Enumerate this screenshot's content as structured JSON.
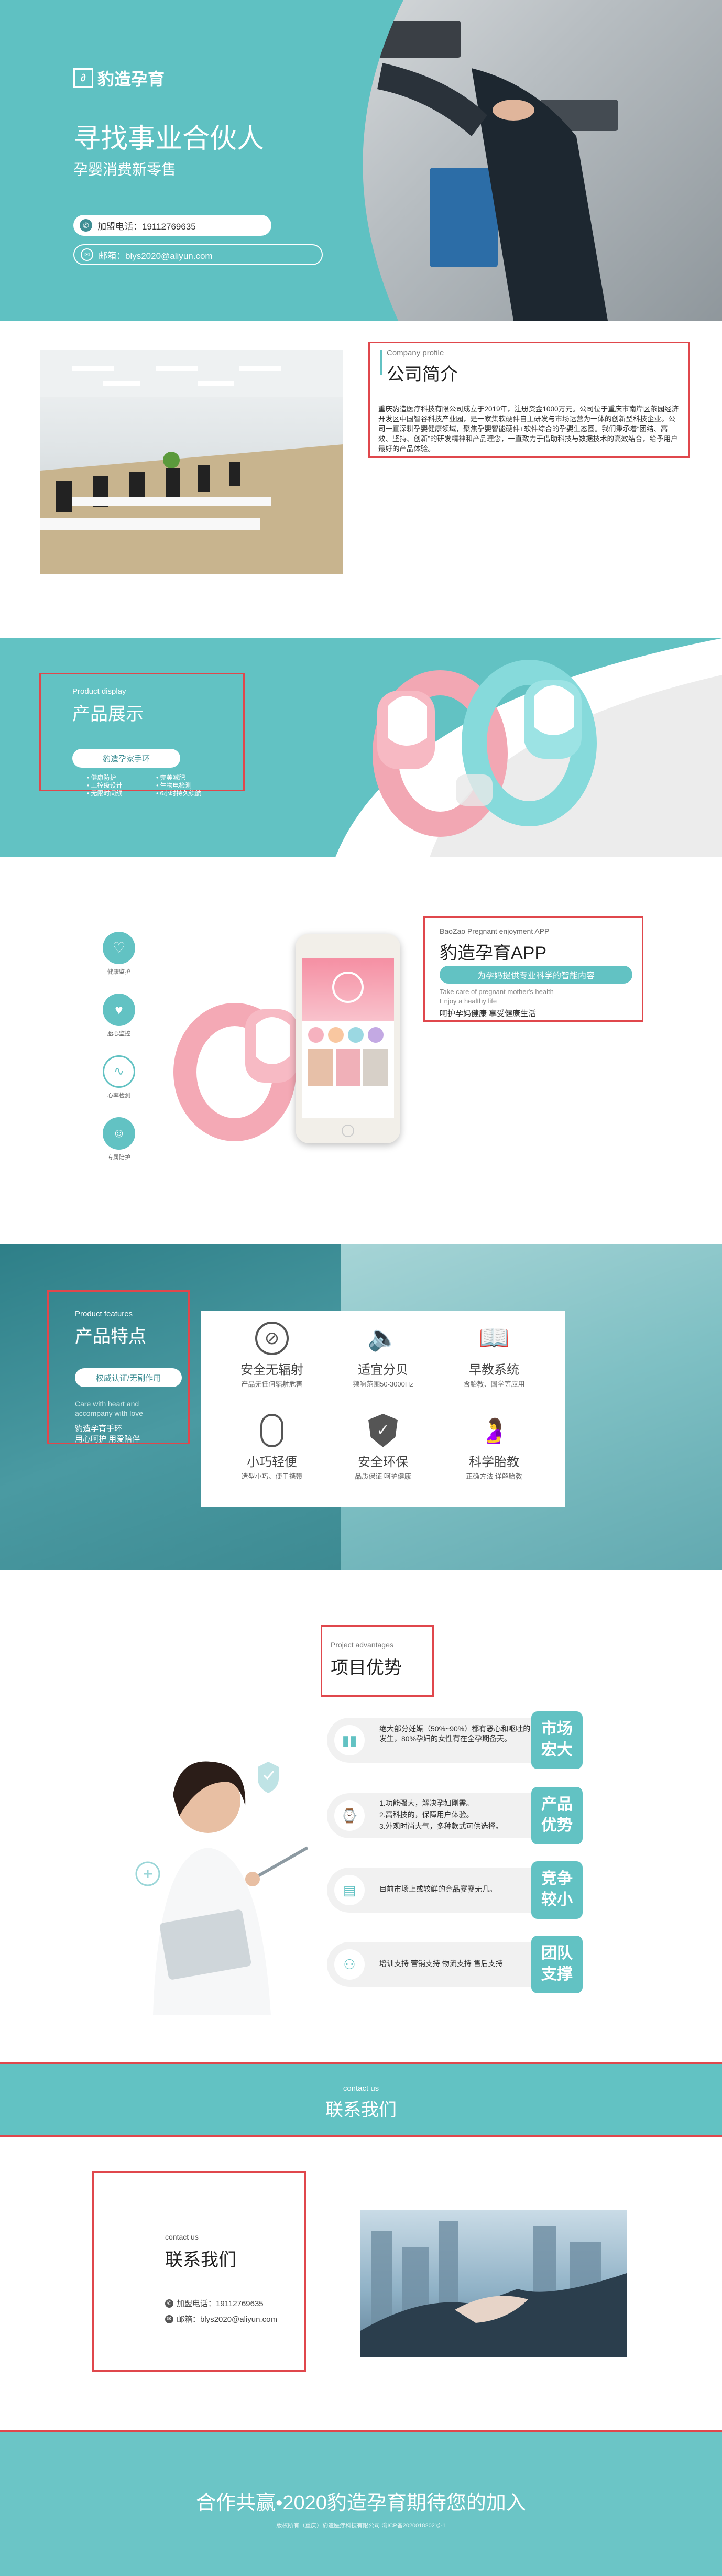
{
  "hero": {
    "logo_text": "豹造孕育",
    "title": "寻找事业合伙人",
    "subtitle": "孕婴消费新零售",
    "phone": "加盟电话：19112769635",
    "email": "邮箱：blys2020@aliyun.com"
  },
  "company": {
    "en_label": "Company profile",
    "title": "公司简介",
    "body": "重庆豹造医疗科技有限公司成立于2019年，注册资金1000万元。公司位于重庆市南岸区茶园经济开发区中国智谷科技产业园，是一家集软硬件自主研发与市场运营为一体的创新型科技企业。公司一直深耕孕婴健康领域，聚焦孕婴智能硬件+软件综合的孕婴生态圈。我们秉承着“团结、高效、坚持、创新”的研发精神和产品理念，一直致力于借助科技与数据技术的高效结合，给予用户最好的产品体验。"
  },
  "product_display": {
    "en_label": "Product display",
    "title": "产品展示",
    "button": "豹造孕家手环",
    "features_left": [
      "• 健康防护",
      "• 工控级设计",
      "• 无限时间线"
    ],
    "features_right": [
      "• 完美减肥",
      "• 生物电检测",
      "• 6小时持久续航"
    ]
  },
  "app": {
    "en_label": "BaoZao Pregnant enjoyment APP",
    "title": "豹造孕育APP",
    "tag": "为孕妈提供专业科学的智能内容",
    "en_sub1": "Take care of pregnant mother's health",
    "en_sub2": "Enjoy a healthy life",
    "desc": "呵护孕妈健康 享受健康生活",
    "icon_labels": [
      "健康监护",
      "胎心监控",
      "心率检测",
      "专属陪护"
    ]
  },
  "features": {
    "en_label": "Product features",
    "title": "产品特点",
    "button": "权威认证/无副作用",
    "en_sub1": "Care with heart and",
    "en_sub2": "accompany with love",
    "desc1": "豹造孕育手环",
    "desc2": "用心呵护 用爱陪伴",
    "items": [
      {
        "title": "安全无辐射",
        "sub": "产品无任何辐射危害"
      },
      {
        "title": "适宜分贝",
        "sub": "频响范围50-3000Hz"
      },
      {
        "title": "早教系统",
        "sub": "含胎教、国学等应用"
      },
      {
        "title": "小巧轻便",
        "sub": "造型小巧、便于携带"
      },
      {
        "title": "安全环保",
        "sub": "品质保证 呵护健康"
      },
      {
        "title": "科学胎教",
        "sub": "正确方法 详解胎教"
      }
    ]
  },
  "advantages": {
    "en_label": "Project advantages",
    "title": "项目优势",
    "items": [
      {
        "text": "绝大部分妊娠（50%~90%）都有恶心和呕吐的发生，80%孕妇的女性有在全孕期备天。",
        "badge1": "市场",
        "badge2": "宏大"
      },
      {
        "text": "1.功能强大，解决孕妇刚需。\n2.高科技的，保障用户体验。\n3.外观时尚大气，多种款式可供选择。",
        "badge1": "产品",
        "badge2": "优势"
      },
      {
        "text": "目前市场上或较鲜的竞品寥寥无几。",
        "badge1": "竞争",
        "badge2": "较小"
      },
      {
        "text": "培训支持 营销支持 物流支持 售后支持",
        "badge1": "团队",
        "badge2": "支撑"
      }
    ]
  },
  "contact_banner": {
    "en_label": "contact us",
    "title": "联系我们"
  },
  "contact": {
    "en_label": "contact us",
    "title": "联系我们",
    "phone": "加盟电话：19112769635",
    "email": "邮箱：blys2020@aliyun.com"
  },
  "footer": {
    "slogan": "合作共赢•2020豹造孕育期待您的加入",
    "small": "版权所有（重庆）豹造医疗科技有限公司 渝ICP备2020018202号-1"
  },
  "colors": {
    "teal": "#62c2c3",
    "red_border": "#e0474c",
    "dark_teal": "#3e8e94"
  }
}
